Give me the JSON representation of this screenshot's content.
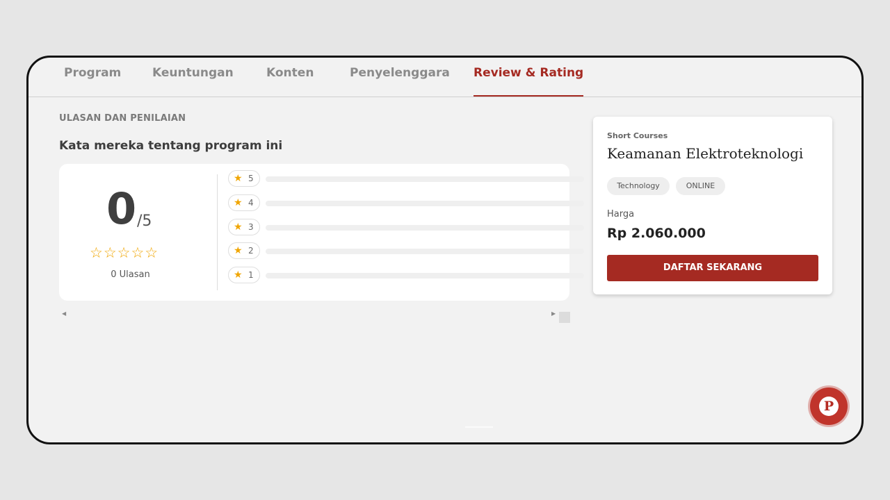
{
  "tabs": [
    {
      "label": "Program",
      "active": false
    },
    {
      "label": "Keuntungan",
      "active": false
    },
    {
      "label": "Konten",
      "active": false
    },
    {
      "label": "Penyelenggara",
      "active": false
    },
    {
      "label": "Review & Rating",
      "active": true
    }
  ],
  "reviews": {
    "section_label": "ULASAN DAN PENILAIAN",
    "title": "Kata mereka tentang program ini",
    "score": "0",
    "score_max": "/5",
    "stars": "☆☆☆☆☆",
    "count_text": "0 Ulasan",
    "breakdown": [
      {
        "star": "5",
        "fraction": 0
      },
      {
        "star": "4",
        "fraction": 0
      },
      {
        "star": "3",
        "fraction": 0
      },
      {
        "star": "2",
        "fraction": 0
      },
      {
        "star": "1",
        "fraction": 0
      }
    ]
  },
  "course": {
    "category": "Short Courses",
    "title": "Keamanan Elektroteknologi",
    "tags": [
      "Technology",
      "ONLINE"
    ],
    "price_label": "Harga",
    "price": "Rp 2.060.000",
    "cta_label": "DAFTAR SEKARANG"
  },
  "chat": {
    "icon": "chat-bubble-p-icon",
    "glyph": "P"
  },
  "colors": {
    "accent": "#a52a22",
    "star": "#f0a500",
    "background": "#f2f2f2"
  }
}
